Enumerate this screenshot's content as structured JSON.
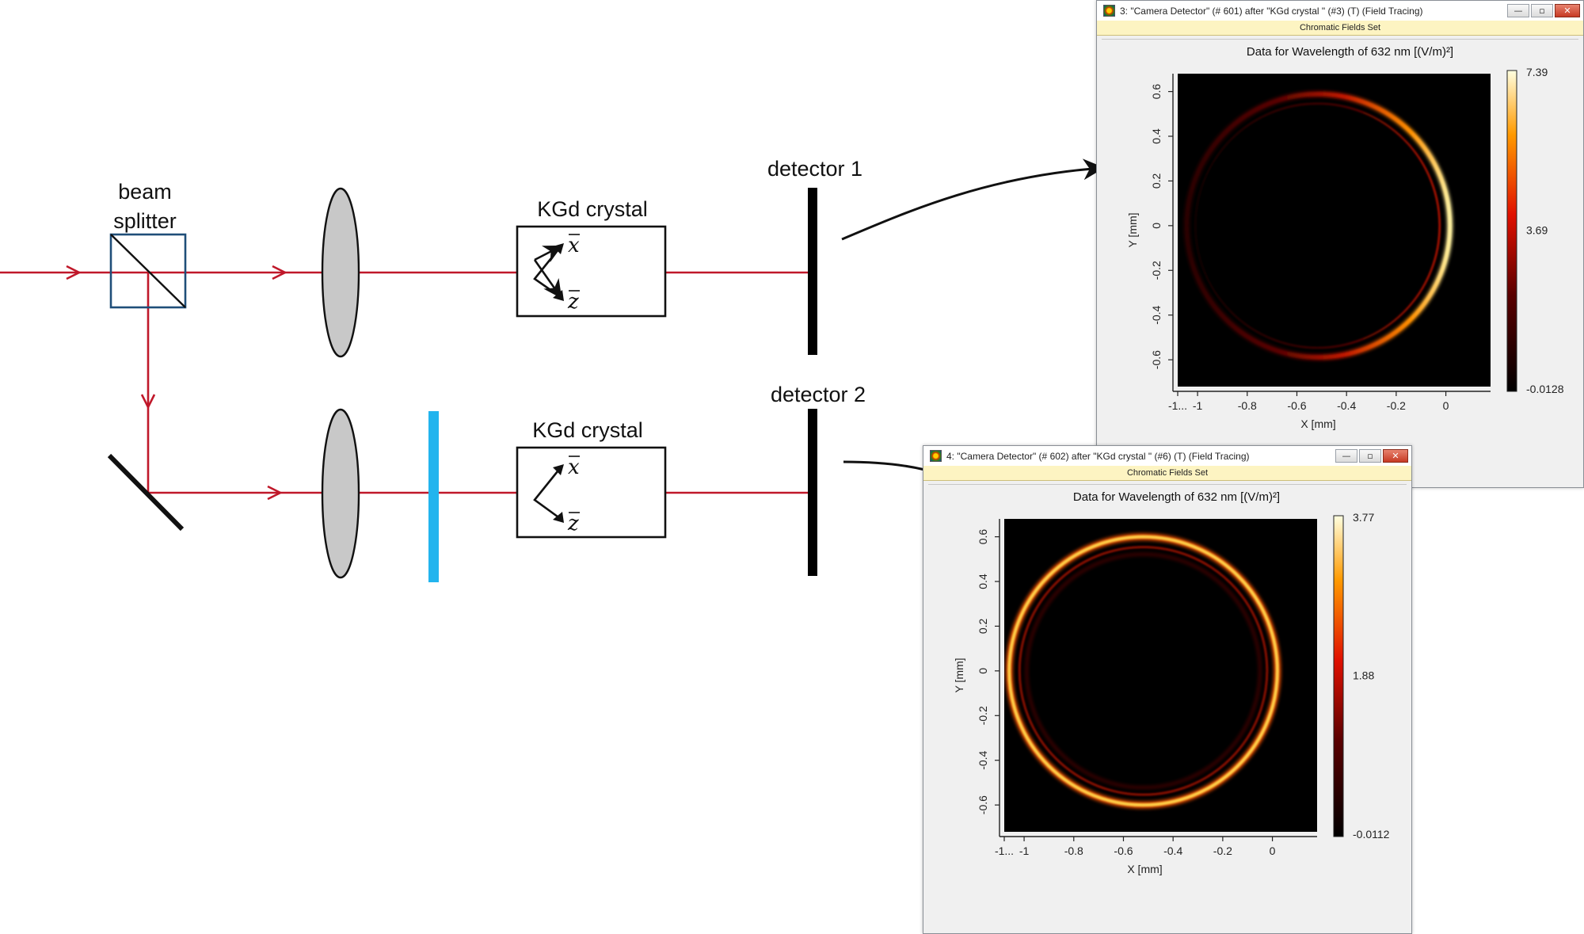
{
  "labels": {
    "beam_splitter_line1": "beam",
    "beam_splitter_line2": "splitter",
    "crystal_top": "KGd crystal",
    "crystal_bottom": "KGd crystal",
    "axis_x": "x",
    "axis_z": "z",
    "detector1": "detector 1",
    "detector2": "detector 2"
  },
  "colors": {
    "beam": "#c0182a",
    "lens": "#c8c8c8",
    "waveplate": "#22b4ee",
    "beam_splitter": "#1f4e79",
    "detector": "#000000"
  },
  "windows": [
    {
      "title": "3: \"Camera Detector\" (# 601) after \"KGd crystal \" (#3) (T) (Field Tracing)",
      "subtitle": "Chromatic Fields Set",
      "plot_title": "Data for Wavelength of 632 nm  [(V/m)²]",
      "xlabel": "X [mm]",
      "ylabel": "Y [mm]",
      "xticks": [
        "-1...",
        "-1",
        "-0.8",
        "-0.6",
        "-0.4",
        "-0.2",
        "0"
      ],
      "yticks": [
        "0.6",
        "0.4",
        "0.2",
        "0",
        "-0.2",
        "-0.4",
        "-0.6"
      ],
      "colorbar": {
        "max": "7.39",
        "mid": "3.69",
        "min": "-0.0128"
      },
      "ring": {
        "center_x": -0.52,
        "center_y": 0.0,
        "radius": 0.53,
        "bright_side": "right"
      }
    },
    {
      "title": "4: \"Camera Detector\" (# 602) after \"KGd crystal \" (#6) (T) (Field Tracing)",
      "subtitle": "Chromatic Fields Set",
      "plot_title": "Data for Wavelength of 632 nm  [(V/m)²]",
      "xlabel": "X [mm]",
      "ylabel": "Y [mm]",
      "xticks": [
        "-1...",
        "-1",
        "-0.8",
        "-0.6",
        "-0.4",
        "-0.2",
        "0"
      ],
      "yticks": [
        "0.6",
        "0.4",
        "0.2",
        "0",
        "-0.2",
        "-0.4",
        "-0.6"
      ],
      "colorbar": {
        "max": "3.77",
        "mid": "1.88",
        "min": "-0.0112"
      },
      "ring": {
        "center_x": -0.52,
        "center_y": 0.0,
        "radius": 0.54,
        "bright_side": "uniform"
      }
    }
  ],
  "window_buttons": {
    "minimize": "—",
    "maximize": "▫",
    "close": "✕"
  }
}
